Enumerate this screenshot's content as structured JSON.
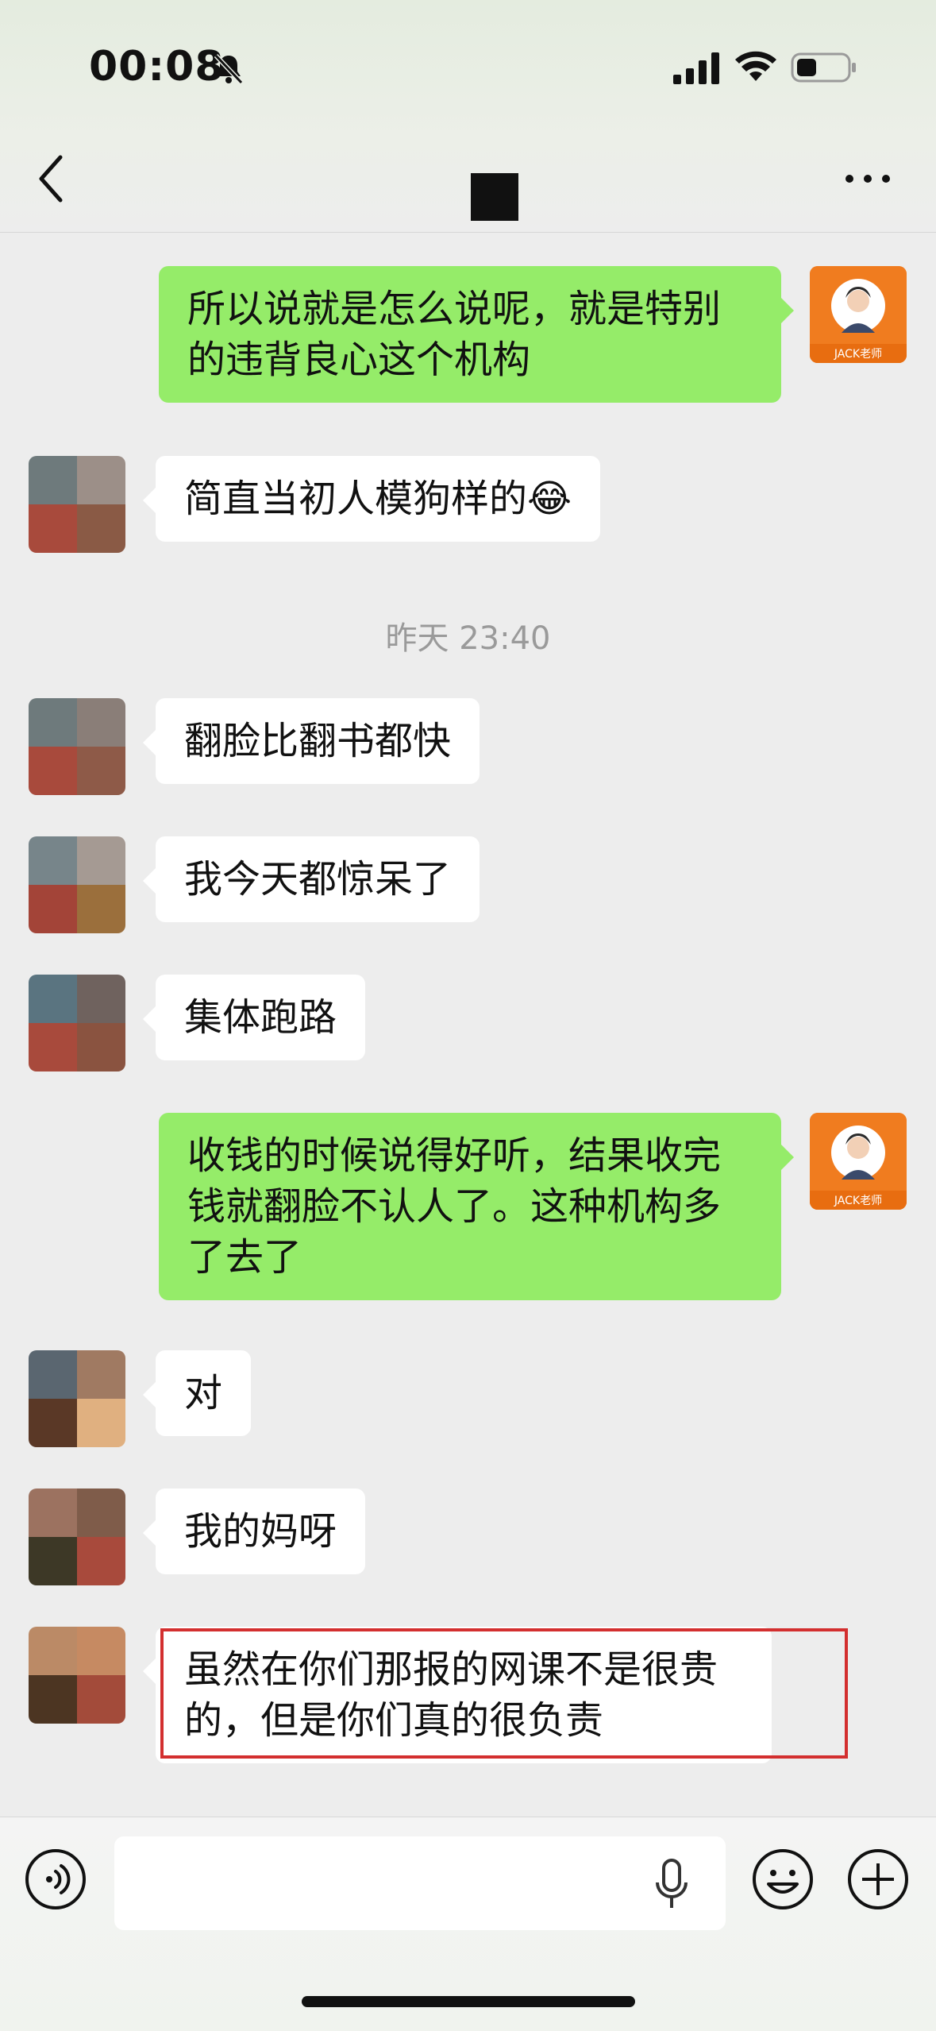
{
  "status_bar": {
    "time": "00:08"
  },
  "chat_header": {
    "title": ""
  },
  "messages": [
    {
      "side": "out",
      "text": "所以说就是怎么说呢，就是特别的违背良心这个机构"
    },
    {
      "side": "in",
      "text": "简直当初人模狗样的😂"
    },
    {
      "side": "in",
      "text": "翻脸比翻书都快"
    },
    {
      "side": "in",
      "text": "我今天都惊呆了"
    },
    {
      "side": "in",
      "text": "集体跑路"
    },
    {
      "side": "out",
      "text": "收钱的时候说得好听，结果收完钱就翻脸不认人了。这种机构多了去了"
    },
    {
      "side": "in",
      "text": "对"
    },
    {
      "side": "in",
      "text": "我的妈呀"
    },
    {
      "side": "in",
      "text": "虽然在你们那报的网课不是很贵的，但是你们真的很负责",
      "highlighted": true
    }
  ],
  "timestamp": "昨天 23:40",
  "avatar_text": {
    "me_badge": "JACK老师"
  },
  "input_bar": {
    "placeholder": ""
  },
  "colors": {
    "outgoing_bubble": "#95ec69",
    "incoming_bubble": "#ffffff",
    "background": "#ededed",
    "highlight_border": "#d32f2f"
  },
  "icons": [
    "back-icon",
    "more-icon",
    "voice-icon",
    "mic-icon",
    "emoji-icon",
    "plus-icon",
    "bell-mute-icon",
    "signal-icon",
    "wifi-icon",
    "battery-icon"
  ]
}
